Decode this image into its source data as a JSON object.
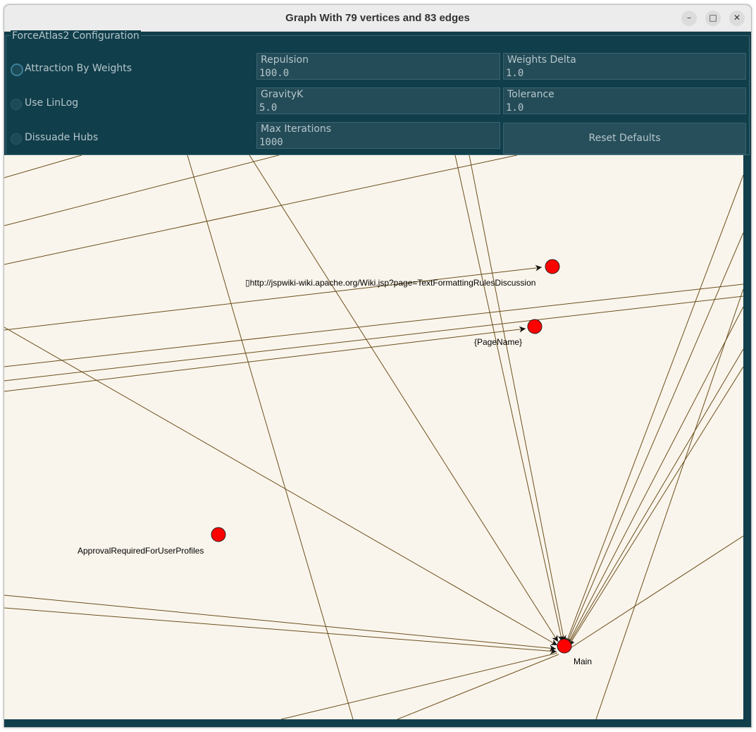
{
  "window": {
    "title": "Graph With 79 vertices and 83 edges",
    "controls": {
      "minimize": "–",
      "maximize": "□",
      "close": "✕"
    }
  },
  "config": {
    "legend": "ForceAtlas2 Configuration",
    "options": [
      {
        "label": "Attraction By Weights",
        "checked": false,
        "focused": true
      },
      {
        "label": "Use LinLog",
        "checked": false,
        "focused": false
      },
      {
        "label": "Dissuade Hubs",
        "checked": false,
        "focused": false
      }
    ],
    "fields": {
      "repulsion": {
        "label": "Repulsion",
        "value": "100.0"
      },
      "weights_delta": {
        "label": "Weights Delta",
        "value": "1.0"
      },
      "gravity_k": {
        "label": "GravityK",
        "value": "5.0"
      },
      "tolerance": {
        "label": "Tolerance",
        "value": "1.0"
      },
      "max_iterations": {
        "label": "Max Iterations",
        "value": "1000"
      }
    },
    "reset_label": "Reset Defaults"
  },
  "graph": {
    "node_color": "#ff0000",
    "edge_color": "#6b4f1d",
    "background": "#faf5ec",
    "labels": {
      "discussion": "▯http://jspwiki-wiki.apache.org/Wiki.jsp?page=TextFormattingRulesDiscussion",
      "pagename": "{PageName}",
      "approval": "ApprovalRequiredForUserProfiles",
      "main": "Main"
    }
  },
  "colors": {
    "panel_bg": "#113e4b",
    "field_bg": "#244c58",
    "panel_text": "#b5c6cb"
  }
}
